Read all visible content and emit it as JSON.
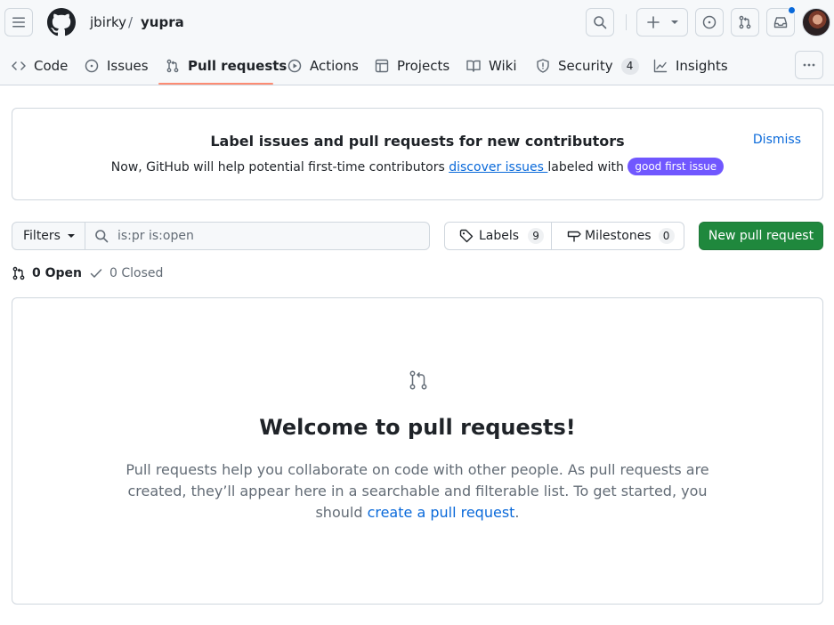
{
  "header": {
    "owner": "jbirky",
    "separator": "/",
    "repo": "yupra"
  },
  "tabs": [
    {
      "label": "Code",
      "icon": "code-icon"
    },
    {
      "label": "Issues",
      "icon": "issue-opened-icon"
    },
    {
      "label": "Pull requests",
      "icon": "git-pull-request-icon",
      "selected": true
    },
    {
      "label": "Actions",
      "icon": "play-icon"
    },
    {
      "label": "Projects",
      "icon": "table-icon"
    },
    {
      "label": "Wiki",
      "icon": "book-icon"
    },
    {
      "label": "Security",
      "icon": "shield-icon",
      "count": "4"
    },
    {
      "label": "Insights",
      "icon": "graph-icon"
    }
  ],
  "banner": {
    "title": "Label issues and pull requests for new contributors",
    "text_before": "Now, GitHub will help potential first-time contributors ",
    "link": "discover issues ",
    "text_after": "labeled with ",
    "label": "good first issue",
    "label_color": "#7057ff",
    "dismiss": "Dismiss"
  },
  "filters": {
    "filters_label": "Filters",
    "search_value": "is:pr is:open",
    "labels_label": "Labels",
    "labels_count": "9",
    "milestones_label": "Milestones",
    "milestones_count": "0",
    "new_pr_label": "New pull request",
    "new_pr_color": "#1f883d"
  },
  "states": {
    "open": "0 Open",
    "closed": "0 Closed"
  },
  "blankslate": {
    "title": "Welcome to pull requests!",
    "text": "Pull requests help you collaborate on code with other people. As pull requests are created, they’ll appear here in a searchable and filterable list. To get started, you should ",
    "link": "create a pull request",
    "suffix": "."
  },
  "colors": {
    "accent": "#0969da",
    "tab_underline": "#fd8c73"
  }
}
